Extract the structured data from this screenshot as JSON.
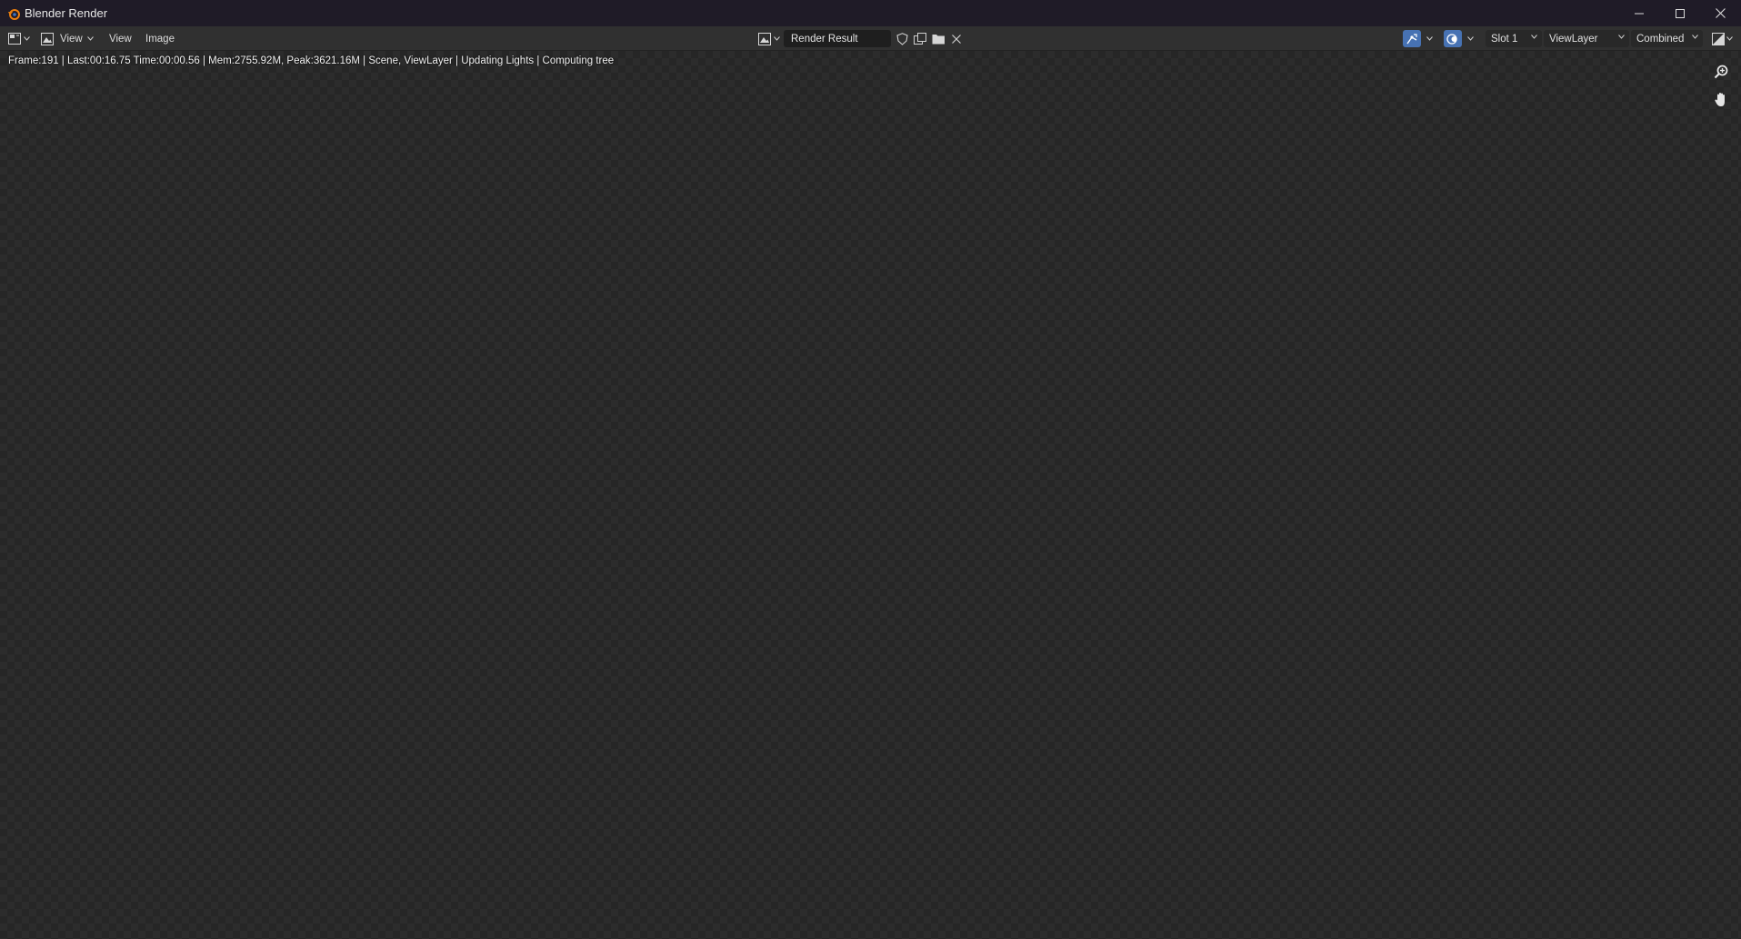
{
  "window": {
    "title": "Blender Render",
    "controls": [
      "minimize",
      "maximize",
      "close"
    ]
  },
  "header": {
    "editor_type_icon": "image-editor-icon",
    "mode_label": "View",
    "menu": [
      {
        "label": "View"
      },
      {
        "label": "Image"
      }
    ],
    "image_name": "Render Result",
    "slot": "Slot 1",
    "view_layer": "ViewLayer",
    "pass": "Combined"
  },
  "viewport": {
    "status": "Frame:191 | Last:00:16.75 Time:00:00.56 | Mem:2755.92M, Peak:3621.16M | Scene, ViewLayer | Updating Lights | Computing tree"
  },
  "colors": {
    "titlebar": "#1f1b27",
    "header": "#303030",
    "accent": "#4772b3",
    "blender_orange": "#e87d0d"
  }
}
